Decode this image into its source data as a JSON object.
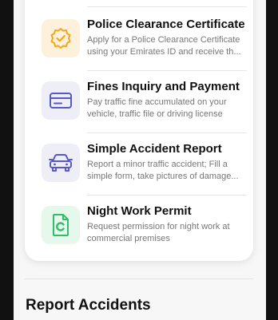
{
  "services": [
    {
      "title": "Police Clearance Certificate",
      "description": "Apply for a Police Clearance Certificate using your Emirates ID and receive th...",
      "icon": "badge-check-icon",
      "icon_bg": "#fdf1dc",
      "icon_color": "#f0a81c"
    },
    {
      "title": "Fines Inquiry and Payment",
      "description": "Pay traffic fine accumulated on your vehicle, traffic file or driving license",
      "icon": "credit-card-icon",
      "icon_bg": "#eeeef6",
      "icon_color": "#5a57c8"
    },
    {
      "title": "Simple Accident Report",
      "description": "Report a minor traffic accident; Fill a simple form, take pictures of damage...",
      "icon": "car-icon",
      "icon_bg": "#eeeef6",
      "icon_color": "#5a57c8"
    },
    {
      "title": "Night Work Permit",
      "description": "Request permission for night work at commercial premises",
      "icon": "document-icon",
      "icon_bg": "#e6f7ec",
      "icon_color": "#2fbf68"
    }
  ],
  "section": {
    "title": "Report Accidents"
  }
}
